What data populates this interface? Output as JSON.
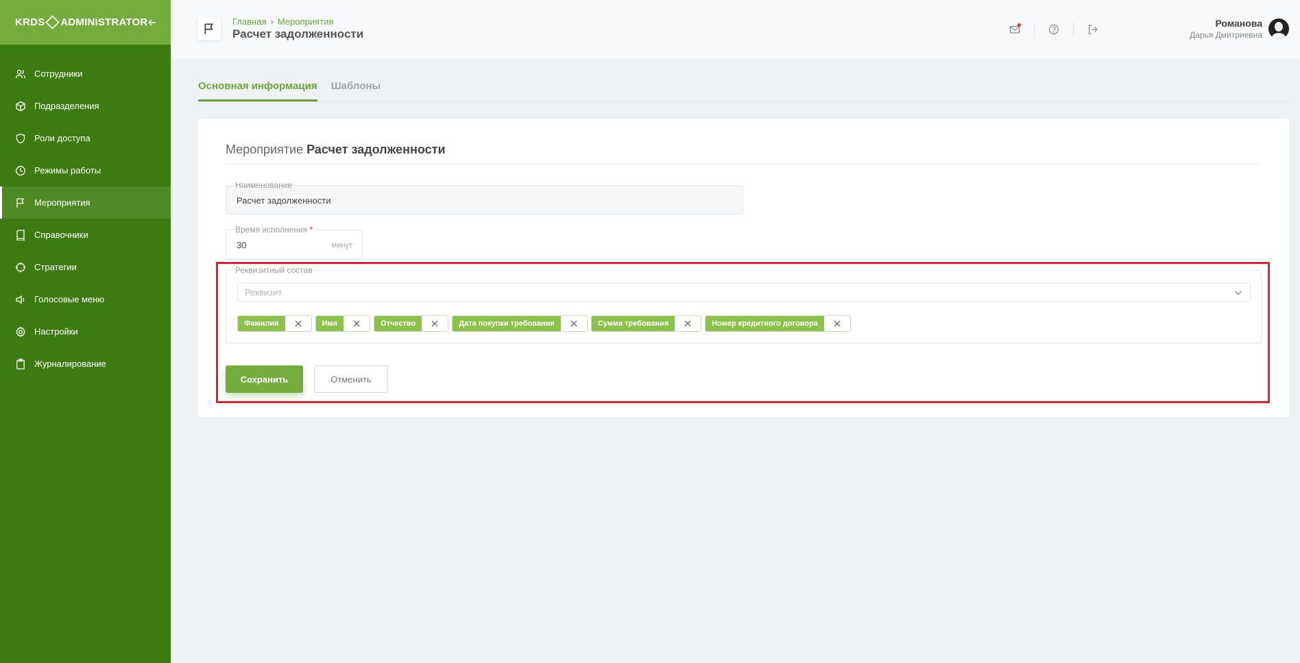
{
  "sidebar": {
    "logo_left": "KRDS",
    "logo_right": "ADMINISTRATOR",
    "items": [
      {
        "label": "Сотрудники",
        "icon": "users-icon"
      },
      {
        "label": "Подразделения",
        "icon": "cube-icon"
      },
      {
        "label": "Роли доступа",
        "icon": "shield-icon"
      },
      {
        "label": "Режимы работы",
        "icon": "clock-icon"
      },
      {
        "label": "Мероприятия",
        "icon": "flag-icon",
        "active": true
      },
      {
        "label": "Справочники",
        "icon": "book-icon"
      },
      {
        "label": "Стратегии",
        "icon": "crosshair-icon"
      },
      {
        "label": "Голосовые меню",
        "icon": "speaker-icon"
      },
      {
        "label": "Настройки",
        "icon": "gear-icon"
      },
      {
        "label": "Журналирование",
        "icon": "clipboard-icon"
      }
    ]
  },
  "header": {
    "breadcrumb": [
      "Главная",
      "Мероприятия"
    ],
    "breadcrumb_sep": "›",
    "title": "Расчет задолженности",
    "user_last_name": "Романова",
    "user_first_name": "Дарья Дмитриевна"
  },
  "tabs": [
    "Основная информация",
    "Шаблоны"
  ],
  "form": {
    "title_prefix": "Мероприятие",
    "title_name": "Расчет задолженности",
    "name_label": "Наименование",
    "name_value": "Расчет задолженности",
    "time_label": "Время исполнения",
    "time_required": "*",
    "time_value": "30",
    "time_unit": "минут",
    "props_label": "Реквизитный состав",
    "props_placeholder": "Реквизит",
    "chips": [
      "Фамилия",
      "Имя",
      "Отчество",
      "Дата покупки требования",
      "Сумма требования",
      "Номер кредитного договора"
    ],
    "save_label": "Сохранить",
    "cancel_label": "Отменить"
  },
  "colors": {
    "sidebar_bg": "#3c7b0f",
    "sidebar_head": "#74ac3d",
    "accent": "#6aa536",
    "chip_bg": "#8bc34a",
    "highlight": "#e0212f"
  }
}
